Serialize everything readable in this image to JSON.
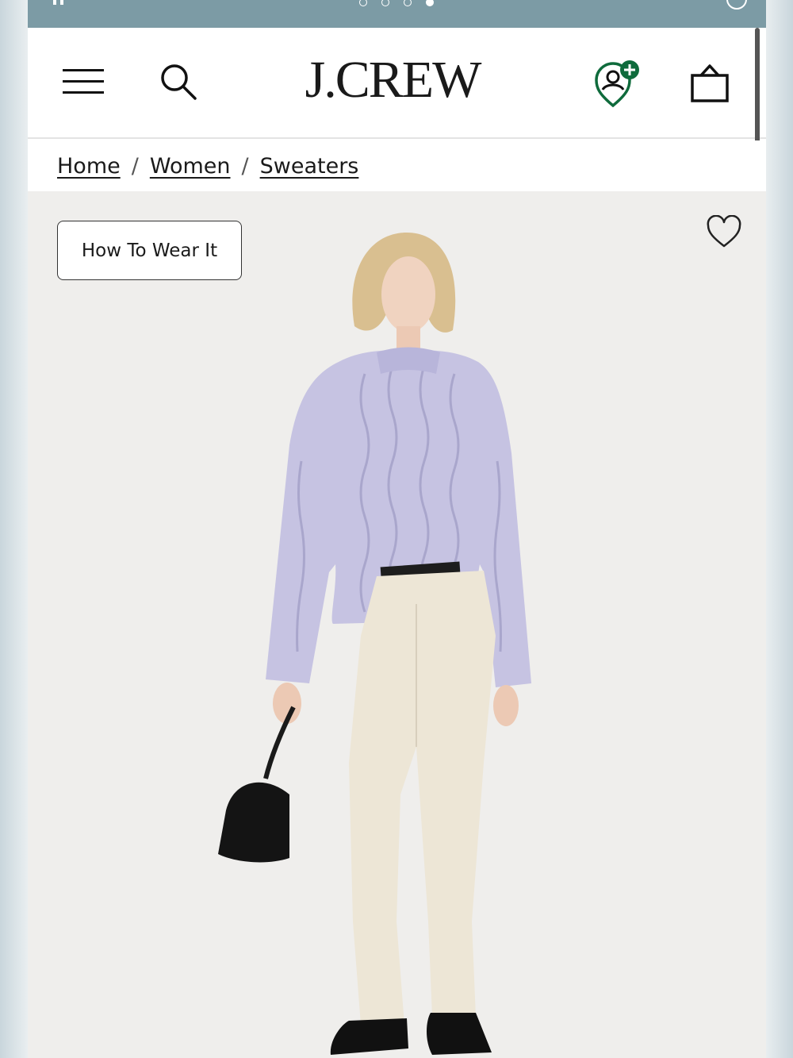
{
  "promo": {
    "slide_count": 4,
    "active_slide": 4,
    "icons": {
      "pause": "pause-icon",
      "account": "user-circle-icon"
    }
  },
  "header": {
    "logo": "J.CREW",
    "icons": {
      "menu": "hamburger-menu-icon",
      "search": "search-icon",
      "rewards": "rewards-plus-icon",
      "bag": "shopping-bag-icon"
    },
    "accent_color": "#0f6b3c"
  },
  "breadcrumb": {
    "items": [
      "Home",
      "Women",
      "Sweaters"
    ],
    "separator": "/"
  },
  "product": {
    "how_to_wear_label": "How To Wear It",
    "wishlist_icon": "heart-outline-icon",
    "image_subject": "model in lavender cable-knit sweater and cream jeans"
  }
}
